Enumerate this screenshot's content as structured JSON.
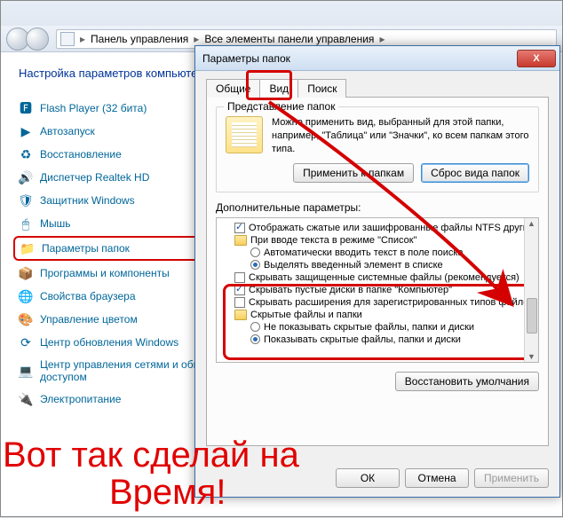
{
  "breadcrumb": {
    "part1": "Панель управления",
    "part2": "Все элементы панели управления"
  },
  "cp": {
    "title": "Настройка параметров компьютера",
    "items": [
      {
        "label": "Flash Player (32 бита)",
        "icon": "🅵"
      },
      {
        "label": "Автозапуск",
        "icon": "▶"
      },
      {
        "label": "Восстановление",
        "icon": "♻"
      },
      {
        "label": "Диспетчер Realtek HD",
        "icon": "🔊"
      },
      {
        "label": "Защитник Windows",
        "icon": "🛡"
      },
      {
        "label": "Мышь",
        "icon": "🖱"
      },
      {
        "label": "Параметры папок",
        "icon": "📁"
      },
      {
        "label": "Программы и компоненты",
        "icon": "📦"
      },
      {
        "label": "Свойства браузера",
        "icon": "🌐"
      },
      {
        "label": "Управление цветом",
        "icon": "🎨"
      },
      {
        "label": "Центр обновления Windows",
        "icon": "⟳"
      },
      {
        "label": "Центр управления сетями и общим доступом",
        "icon": "💻"
      },
      {
        "label": "Электропитание",
        "icon": "🔌"
      }
    ],
    "highlight_index": 6
  },
  "dialog": {
    "title": "Параметры папок",
    "close": "X",
    "tabs": {
      "general": "Общие",
      "view": "Вид",
      "search": "Поиск"
    },
    "view_group": {
      "legend": "Представление папок",
      "text": "Можно применить вид, выбранный для этой папки, например, \"Таблица\" или \"Значки\", ко всем папкам этого типа.",
      "apply_btn": "Применить к папкам",
      "reset_btn": "Сброс вида папок"
    },
    "advanced_label": "Дополнительные параметры:",
    "tree": [
      {
        "type": "check",
        "checked": true,
        "label": "Отображать сжатые или зашифрованные файлы NTFS другим цветом"
      },
      {
        "type": "folder-head",
        "label": "При вводе текста в режиме \"Список\""
      },
      {
        "type": "radio",
        "lv": 2,
        "checked": false,
        "label": "Автоматически вводить текст в поле поиска"
      },
      {
        "type": "radio",
        "lv": 2,
        "checked": true,
        "label": "Выделять введенный элемент в списке"
      },
      {
        "type": "check",
        "checked": false,
        "label": "Скрывать защищенные системные файлы (рекомендуется)"
      },
      {
        "type": "check",
        "checked": true,
        "label": "Скрывать пустые диски в папке \"Компьютер\""
      },
      {
        "type": "check",
        "checked": false,
        "label": "Скрывать расширения для зарегистрированных типов файлов"
      },
      {
        "type": "folder-head",
        "label": "Скрытые файлы и папки"
      },
      {
        "type": "radio",
        "lv": 2,
        "checked": false,
        "label": "Не показывать скрытые файлы, папки и диски"
      },
      {
        "type": "radio",
        "lv": 2,
        "checked": true,
        "label": "Показывать скрытые файлы, папки и диски"
      }
    ],
    "restore": "Восстановить умолчания",
    "ok": "ОК",
    "cancel": "Отмена",
    "apply": "Применить"
  },
  "annotation": {
    "line1": "Вот так сделай на",
    "line2": "Время!"
  }
}
